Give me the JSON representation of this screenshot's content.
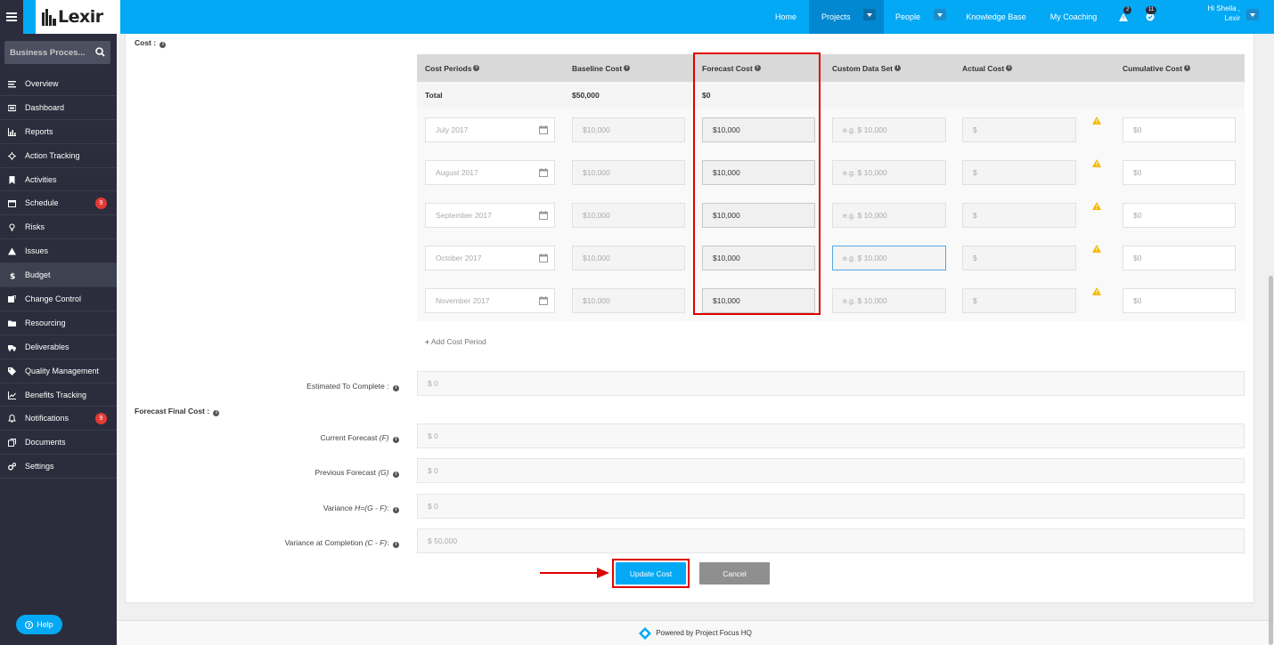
{
  "app": {
    "logo_text": "Lexir"
  },
  "topnav": {
    "items": [
      {
        "label": "Home"
      },
      {
        "label": "Projects"
      },
      {
        "label": "People"
      },
      {
        "label": "Knowledge Base"
      },
      {
        "label": "My Coaching"
      }
    ],
    "alerts_count": "2",
    "tasks_count": "11",
    "user_greeting": "Hi Sheila ,",
    "user_org": "Lexir"
  },
  "sidebar": {
    "search_text": "Business Proces...",
    "items": [
      {
        "label": "Overview",
        "icon": "list-icon"
      },
      {
        "label": "Dashboard",
        "icon": "dashboard-icon"
      },
      {
        "label": "Reports",
        "icon": "bar-chart-icon"
      },
      {
        "label": "Action Tracking",
        "icon": "crosshair-icon"
      },
      {
        "label": "Activities",
        "icon": "bookmark-icon"
      },
      {
        "label": "Schedule",
        "icon": "calendar-icon",
        "badge": "9"
      },
      {
        "label": "Risks",
        "icon": "lightbulb-icon"
      },
      {
        "label": "Issues",
        "icon": "warning-icon"
      },
      {
        "label": "Budget",
        "icon": "dollar-icon"
      },
      {
        "label": "Change Control",
        "icon": "change-icon"
      },
      {
        "label": "Resourcing",
        "icon": "folder-icon"
      },
      {
        "label": "Deliverables",
        "icon": "truck-icon"
      },
      {
        "label": "Quality Management",
        "icon": "tag-icon"
      },
      {
        "label": "Benefits Tracking",
        "icon": "line-chart-icon"
      },
      {
        "label": "Notifications",
        "icon": "bell-icon",
        "badge": "9"
      },
      {
        "label": "Documents",
        "icon": "documents-icon"
      },
      {
        "label": "Settings",
        "icon": "cogs-icon"
      }
    ],
    "help_label": "Help"
  },
  "cost": {
    "section_label": "Cost :",
    "columns": [
      "Cost Periods",
      "Baseline Cost",
      "Forecast Cost",
      "Custom Data Set",
      "Actual Cost",
      "Cumulative Cost"
    ],
    "total": {
      "label": "Total",
      "baseline": "$50,000",
      "forecast": "$0"
    },
    "rows": [
      {
        "period": "July 2017",
        "baseline": "$10,000",
        "forecast": "$10,000",
        "custom_placeholder": "e.g. $ 10,000",
        "actual_placeholder": "$",
        "cumulative": "$0"
      },
      {
        "period": "August 2017",
        "baseline": "$10,000",
        "forecast": "$10,000",
        "custom_placeholder": "e.g. $ 10,000",
        "actual_placeholder": "$",
        "cumulative": "$0"
      },
      {
        "period": "September 2017",
        "baseline": "$10,000",
        "forecast": "$10,000",
        "custom_placeholder": "e.g. $ 10,000",
        "actual_placeholder": "$",
        "cumulative": "$0"
      },
      {
        "period": "October 2017",
        "baseline": "$10,000",
        "forecast": "$10,000",
        "custom_placeholder": "e.g. $ 10,000",
        "actual_placeholder": "$",
        "cumulative": "$0"
      },
      {
        "period": "November 2017",
        "baseline": "$10,000",
        "forecast": "$10,000",
        "custom_placeholder": "e.g. $ 10,000",
        "actual_placeholder": "$",
        "cumulative": "$0"
      }
    ],
    "add_period_label": "Add Cost Period"
  },
  "estimates": {
    "etc_label": "Estimated To Complete :",
    "etc_value": "$ 0",
    "ffc_section_label": "Forecast Final Cost :",
    "current_label": "Current Forecast",
    "current_suffix": "(F)",
    "current_value": "$ 0",
    "previous_label": "Previous Forecast",
    "previous_suffix": "(G)",
    "previous_value": "$ 0",
    "variance_label": "Variance",
    "variance_suffix": "H=(G - F)",
    "variance_value": "$ 0",
    "vac_label": "Variance at Completion",
    "vac_suffix": "(C - F)",
    "vac_value": "$ 50,000"
  },
  "actions": {
    "update_label": "Update Cost",
    "cancel_label": "Cancel"
  },
  "footer": {
    "text": "Powered by Project Focus HQ"
  },
  "colors": {
    "brand": "#03a9f4",
    "sidebar": "#2b2d3c",
    "highlight": "#e00000",
    "warning": "#f5b800",
    "badge": "#e53935"
  }
}
